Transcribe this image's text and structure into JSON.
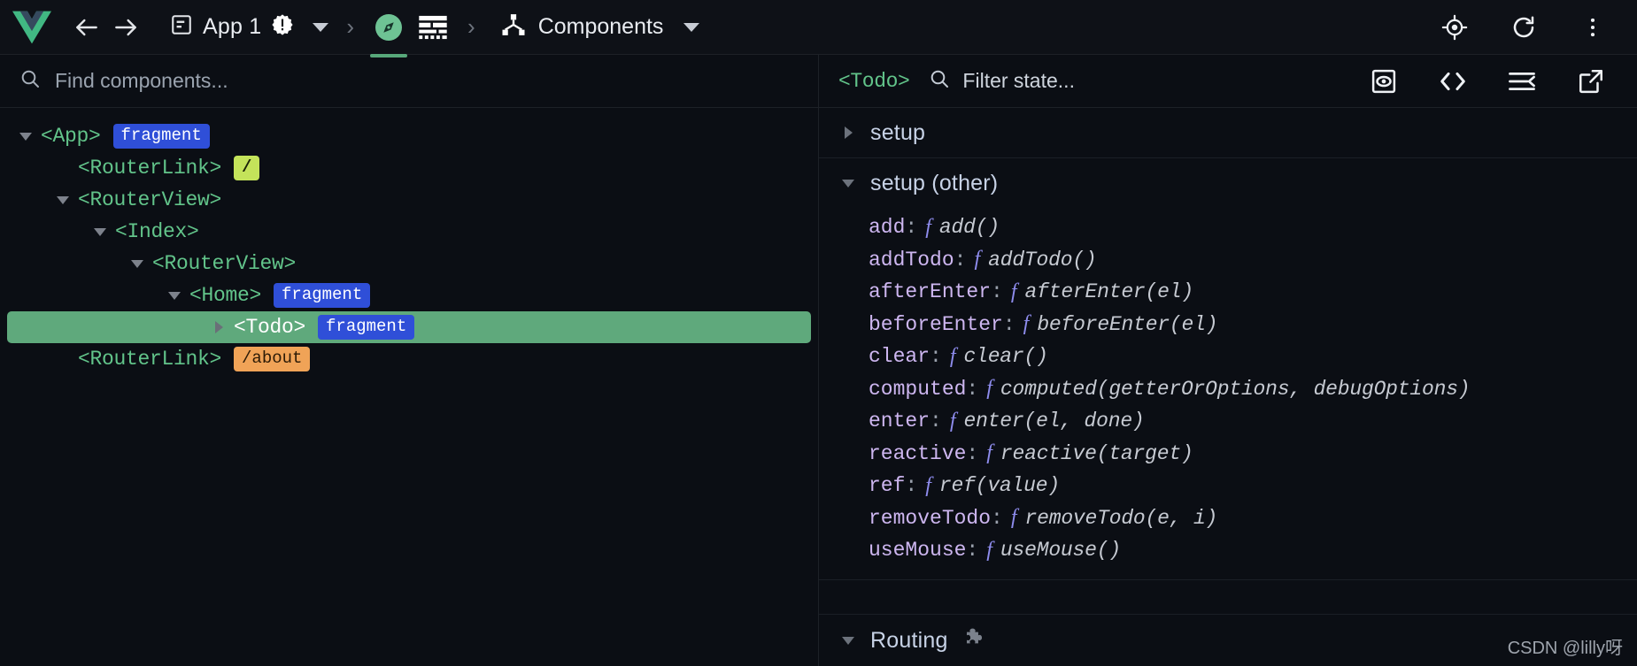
{
  "toolbar": {
    "logo_icon": "vue-logo-icon",
    "back_icon": "back-arrow-icon",
    "forward_icon": "forward-arrow-icon",
    "app_icon": "document-icon",
    "app_label": "App 1",
    "app_badge_icon": "alert-badge-icon",
    "app_dropdown_icon": "chevron-down-icon",
    "separator": "›",
    "tab_compass_icon": "compass-icon",
    "tab_timeline_icon": "timeline-grid-icon",
    "view_icon": "components-tree-icon",
    "view_label": "Components",
    "view_dropdown_icon": "chevron-down-icon",
    "inspect_icon": "target-inspect-icon",
    "refresh_icon": "refresh-icon",
    "more_icon": "more-vertical-icon"
  },
  "left_pane": {
    "search": {
      "icon": "search-icon",
      "placeholder": "Find components...",
      "value": ""
    },
    "tree": [
      {
        "depth": 0,
        "caret": "open",
        "name": "<App>",
        "badge": "fragment",
        "badge_type": "fragment",
        "selected": false
      },
      {
        "depth": 1,
        "caret": "none",
        "name": "<RouterLink>",
        "badge": "/",
        "badge_type": "route-root",
        "selected": false
      },
      {
        "depth": 1,
        "caret": "open",
        "name": "<RouterView>",
        "badge": "",
        "badge_type": "",
        "selected": false
      },
      {
        "depth": 2,
        "caret": "open",
        "name": "<Index>",
        "badge": "",
        "badge_type": "",
        "selected": false
      },
      {
        "depth": 3,
        "caret": "open",
        "name": "<RouterView>",
        "badge": "",
        "badge_type": "",
        "selected": false
      },
      {
        "depth": 4,
        "caret": "open",
        "name": "<Home>",
        "badge": "fragment",
        "badge_type": "fragment",
        "selected": false
      },
      {
        "depth": 5,
        "caret": "closed",
        "name": "<Todo>",
        "badge": "fragment",
        "badge_type": "fragment",
        "selected": true
      },
      {
        "depth": 1,
        "caret": "none",
        "name": "<RouterLink>",
        "badge": "/about",
        "badge_type": "route-about",
        "selected": false
      }
    ]
  },
  "right_pane": {
    "header": {
      "component": "<Todo>",
      "search_icon": "search-icon",
      "filter_placeholder": "Filter state...",
      "filter_value": "",
      "actions": [
        {
          "icon": "inspect-dom-icon"
        },
        {
          "icon": "open-source-code-icon"
        },
        {
          "icon": "collapse-all-icon"
        },
        {
          "icon": "open-external-icon"
        }
      ],
      "highlight_color": "#f0452a"
    },
    "groups": [
      {
        "title": "setup",
        "expanded": false,
        "props": []
      },
      {
        "title": "setup (other)",
        "expanded": true,
        "props": [
          {
            "key": "add",
            "marker": "f",
            "signature": "add()"
          },
          {
            "key": "addTodo",
            "marker": "f",
            "signature": "addTodo()"
          },
          {
            "key": "afterEnter",
            "marker": "f",
            "signature": "afterEnter(el)"
          },
          {
            "key": "beforeEnter",
            "marker": "f",
            "signature": "beforeEnter(el)"
          },
          {
            "key": "clear",
            "marker": "f",
            "signature": "clear()"
          },
          {
            "key": "computed",
            "marker": "f",
            "signature": "computed(getterOrOptions, debugOptions)"
          },
          {
            "key": "enter",
            "marker": "f",
            "signature": "enter(el, done)"
          },
          {
            "key": "reactive",
            "marker": "f",
            "signature": "reactive(target)"
          },
          {
            "key": "ref",
            "marker": "f",
            "signature": "ref(value)"
          },
          {
            "key": "removeTodo",
            "marker": "f",
            "signature": "removeTodo(e, i)"
          },
          {
            "key": "useMouse",
            "marker": "f",
            "signature": "useMouse()"
          }
        ]
      }
    ],
    "routing": {
      "title": "Routing",
      "expanded": true,
      "icon": "puzzle-piece-icon"
    }
  },
  "watermark": "CSDN @lilly呀",
  "colors": {
    "background": "#0b0e14",
    "toolbar_background": "#0e1117",
    "accent_green": "#57a87a",
    "component_green": "#62c48a",
    "selected_row": "#5fa97c",
    "badge_fragment": "#2f4fd8",
    "badge_route_root": "#c4e35a",
    "badge_route_about": "#f0a357",
    "prop_key": "#cdb6f0",
    "highlight_box": "#f0452a"
  }
}
